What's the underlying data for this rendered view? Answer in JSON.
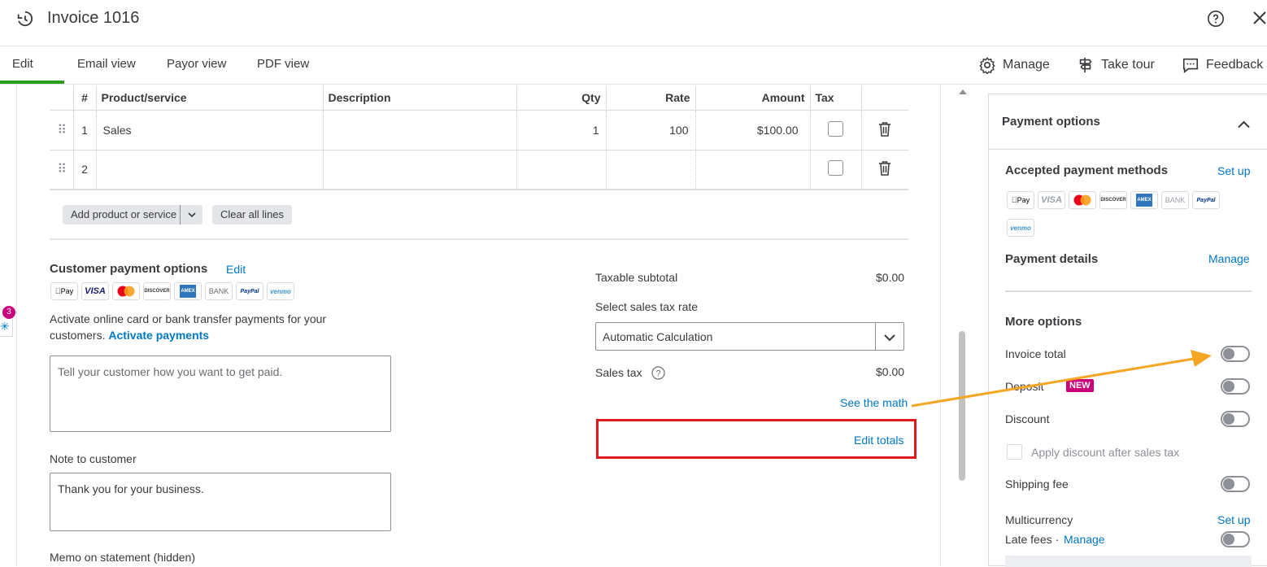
{
  "header": {
    "title": "Invoice 1016"
  },
  "tabs": [
    {
      "label": "Edit"
    },
    {
      "label": "Email view"
    },
    {
      "label": "Payor view"
    },
    {
      "label": "PDF view"
    }
  ],
  "tools": {
    "manage": "Manage",
    "tour": "Take tour",
    "feedback": "Feedback"
  },
  "table": {
    "headers": [
      "#",
      "Product/service",
      "Description",
      "Qty",
      "Rate",
      "Amount",
      "Tax"
    ],
    "rows": [
      {
        "num": "1",
        "product": "Sales",
        "description": "",
        "qty": "1",
        "rate": "100",
        "amount": "$100.00"
      },
      {
        "num": "2",
        "product": "",
        "description": "",
        "qty": "",
        "rate": "",
        "amount": ""
      }
    ]
  },
  "buttons": {
    "add_product": "Add product or service",
    "clear_lines": "Clear all lines"
  },
  "payment": {
    "title": "Customer payment options",
    "edit": "Edit",
    "methods": [
      "Pay",
      "VISA",
      "",
      "DISCOVER",
      "AMEX",
      "BANK",
      "PayPal",
      "venmo"
    ],
    "activate_text": "Activate online card or bank transfer payments for your customers.",
    "activate_link": "Activate payments",
    "message_placeholder": "Tell your customer how you want to get paid."
  },
  "note": {
    "label": "Note to customer",
    "value": "Thank you for your business."
  },
  "memo": {
    "label": "Memo on statement (hidden)"
  },
  "totals": {
    "taxable_subtotal_label": "Taxable subtotal",
    "taxable_subtotal_value": "$0.00",
    "tax_rate_label": "Select sales tax rate",
    "tax_rate_value": "Automatic Calculation",
    "sales_tax_label": "Sales tax",
    "sales_tax_value": "$0.00",
    "see_math": "See the math",
    "edit_totals": "Edit totals"
  },
  "side_badge": "3",
  "panel": {
    "title": "Payment options",
    "accepted_label": "Accepted payment methods",
    "setup": "Set up",
    "methods": [
      "Pay",
      "VISA",
      "",
      "DISCOVER",
      "AMEX",
      "BANK",
      "PayPal",
      "venmo"
    ],
    "details_label": "Payment details",
    "details_manage": "Manage",
    "more_options": "More options",
    "invoice_total": "Invoice total",
    "deposit": "Deposit",
    "new_badge": "NEW",
    "discount": "Discount",
    "apply_discount": "Apply discount after sales tax",
    "shipping_fee": "Shipping fee",
    "multicurrency": "Multicurrency",
    "multicurrency_setup": "Set up",
    "late_fees": "Late fees ·",
    "late_fees_manage": "Manage"
  },
  "colors": {
    "accent_green": "#2ca01c",
    "link_blue": "#0077c5",
    "highlight_red": "#e1171e",
    "arrow_orange": "#f5a623",
    "new_badge": "#c9007a"
  }
}
